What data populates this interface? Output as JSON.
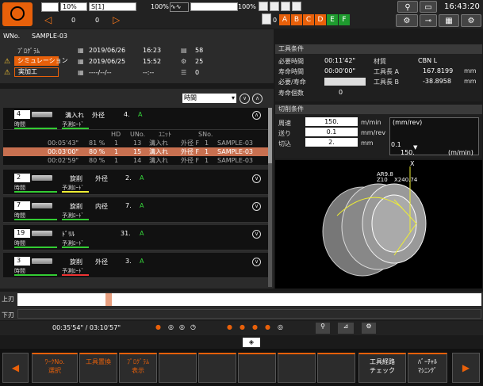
{
  "topbar": {
    "gauge1_label": "10%",
    "gauge2_label": "S[1]",
    "gauge2_value": "100%",
    "gauge3_value": "100%",
    "counter_left": "0",
    "counter_right": "0",
    "time": "16:43:20",
    "tool_indicator": "0"
  },
  "info": {
    "wno_label": "WNo.",
    "wno_value": "SAMPLE-03",
    "program_label": "ﾌﾟﾛｸﾞﾗﾑ",
    "simulation_label": "シミュレーション",
    "actual_label": "実加工",
    "date1": "2019/06/26",
    "time1": "16:23",
    "count1": "58",
    "date2": "2019/06/25",
    "time2": "15:52",
    "count2": "25",
    "date3": "----/--/--",
    "time3": "--:--",
    "count3": "0"
  },
  "list": {
    "sort_label": "時間",
    "header_cols": {
      "hd": "HD",
      "uno": "UNo.",
      "unit": "ﾕﾆｯﾄ",
      "sno": "SNo."
    },
    "time_label": "時間",
    "predict_label": "予測ﾛｰﾄﾞ",
    "items": [
      {
        "num": "4",
        "op": "溝入れ",
        "pos": "外径",
        "idx": "4.",
        "suffix": "A"
      },
      {
        "num": "2",
        "op": "旋削",
        "pos": "外径",
        "idx": "2.",
        "suffix": "A"
      },
      {
        "num": "7",
        "op": "旋削",
        "pos": "内径",
        "idx": "7.",
        "suffix": "A"
      },
      {
        "num": "19",
        "op": "ﾄﾞﾘﾙ",
        "pos": "",
        "idx": "31.",
        "suffix": "A"
      },
      {
        "num": "3",
        "op": "旋削",
        "pos": "外径",
        "idx": "3.",
        "suffix": "A"
      }
    ],
    "subrows": [
      {
        "time": "00:05'43\"",
        "pct": "81 %",
        "hd": "1",
        "uno": "13",
        "unit": "溝入れ",
        "unit2": "外径 F",
        "sno": "1",
        "prog": "SAMPLE-03"
      },
      {
        "time": "00:03'00\"",
        "pct": "80 %",
        "hd": "1",
        "uno": "15",
        "unit": "溝入れ",
        "unit2": "外径 F",
        "sno": "1",
        "prog": "SAMPLE-03"
      },
      {
        "time": "00:02'59\"",
        "pct": "80 %",
        "hd": "1",
        "uno": "14",
        "unit": "溝入れ",
        "unit2": "外径 F",
        "sno": "1",
        "prog": "SAMPLE-03"
      }
    ]
  },
  "tool_cond": {
    "title": "工具条件",
    "req_time_label": "必要時間",
    "req_time": "00:11'42\"",
    "life_time_label": "寿命時間",
    "life_time": "00:00'00\"",
    "req_life_label": "必要/寿命",
    "life_count_label": "寿命個数",
    "life_count": "0",
    "material_label": "材質",
    "material": "CBN L",
    "len_a_label": "工具長 A",
    "len_a": "167.8199",
    "len_a_unit": "mm",
    "len_b_label": "工具長 B",
    "len_b": "-38.8958",
    "len_b_unit": "mm"
  },
  "cut_cond": {
    "title": "切削条件",
    "speed_label": "周速",
    "speed": "150.",
    "speed_unit": "m/min",
    "feed_label": "送り",
    "feed": "0.1",
    "feed_unit": "mm/rev",
    "depth_label": "切込",
    "depth": "2.",
    "depth_unit": "mm",
    "graph_ylabel": "(mm/rev)",
    "graph_y": "0.1",
    "graph_x": "150.",
    "graph_xunit": "(m/min)"
  },
  "view3d": {
    "label1": "AR9.8",
    "label2": "Z10",
    "label3": "X240.74",
    "axis": "X"
  },
  "timeline": {
    "upper": "上刃",
    "lower": "下刃",
    "time_text": "00:35'54\" / 03:10'57\""
  },
  "bottom": {
    "btn1": "ﾜｰｸNo.\n選択",
    "btn2": "工具置換",
    "btn3": "ﾌﾟﾛｸﾞﾗﾑ\n表示",
    "btn4": "工具経路\nチェック",
    "btn5": "ﾊﾞｰﾁｬﾙ\nﾏｼﾆﾝｸﾞ"
  },
  "colors": {
    "accent": "#e8600a",
    "green": "#35d33a",
    "panel": "#2b2b2b"
  }
}
